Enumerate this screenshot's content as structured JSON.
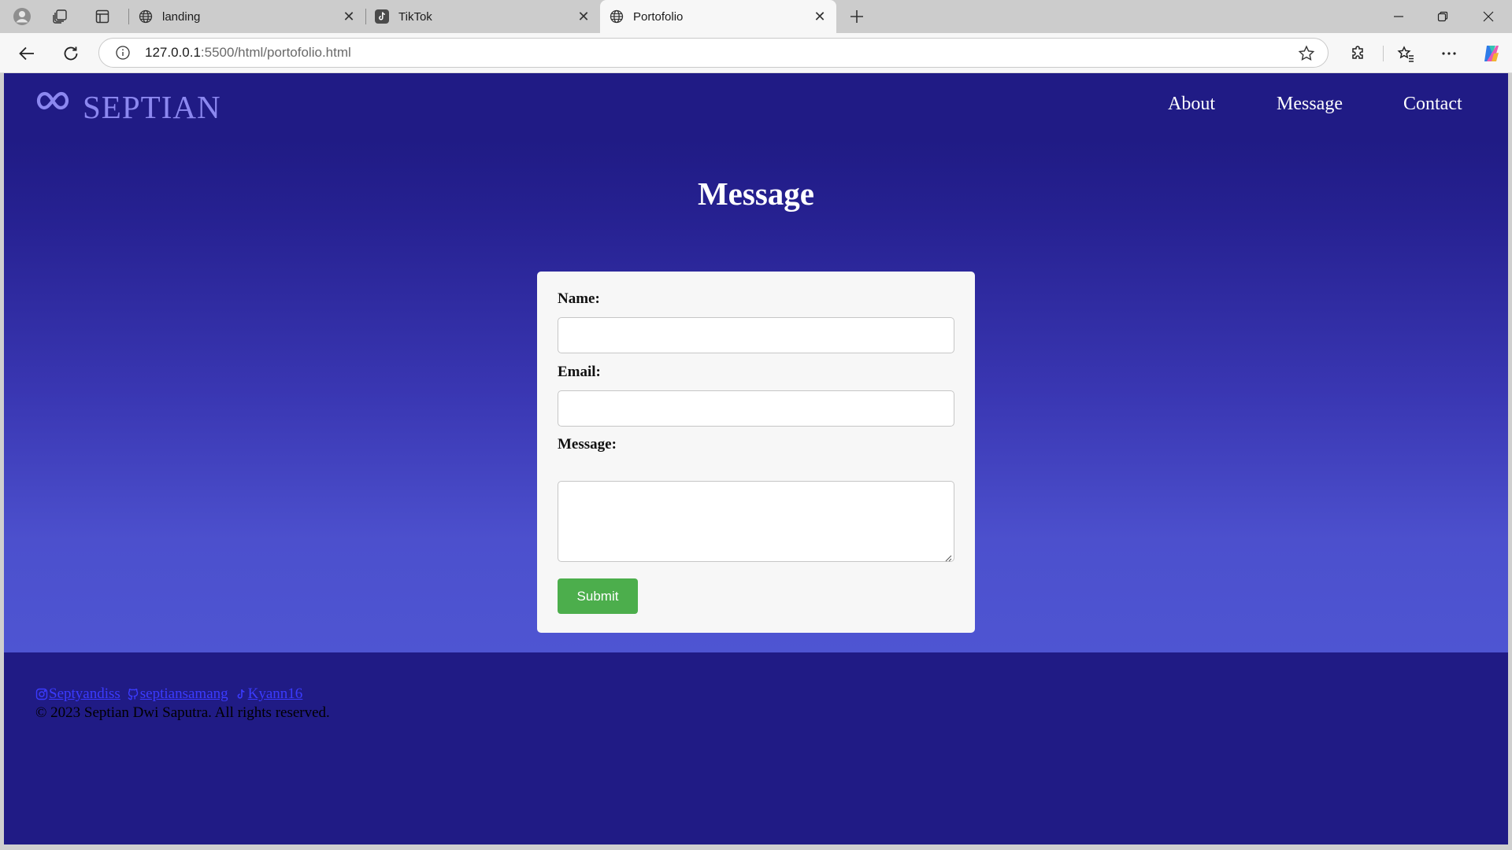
{
  "browser": {
    "tabs": [
      {
        "title": "landing",
        "icon": "globe-icon"
      },
      {
        "title": "TikTok",
        "icon": "tiktok-icon"
      },
      {
        "title": "Portofolio",
        "icon": "globe-icon",
        "active": true
      }
    ],
    "address": {
      "host": "127.0.0.1",
      "rest": ":5500/html/portofolio.html"
    }
  },
  "header": {
    "brand": "SEPTIAN",
    "nav": [
      "About",
      "Message",
      "Contact"
    ]
  },
  "main": {
    "title": "Message",
    "form": {
      "name_label": "Name:",
      "email_label": "Email:",
      "message_label": "Message:",
      "name_value": "",
      "email_value": "",
      "message_value": "",
      "submit_label": "Submit"
    }
  },
  "footer": {
    "social": [
      {
        "label": "Septyandiss",
        "icon": "instagram-icon"
      },
      {
        "label": "septiansamang",
        "icon": "github-icon"
      },
      {
        "label": "Kyann16",
        "icon": "tiktok-icon"
      }
    ],
    "copyright": "© 2023 Septian Dwi Saputra. All rights reserved."
  },
  "colors": {
    "header_bg": "#201b85",
    "brand": "#8c88f0",
    "submit_bg": "#4cae4c",
    "link": "#3b3bff"
  }
}
